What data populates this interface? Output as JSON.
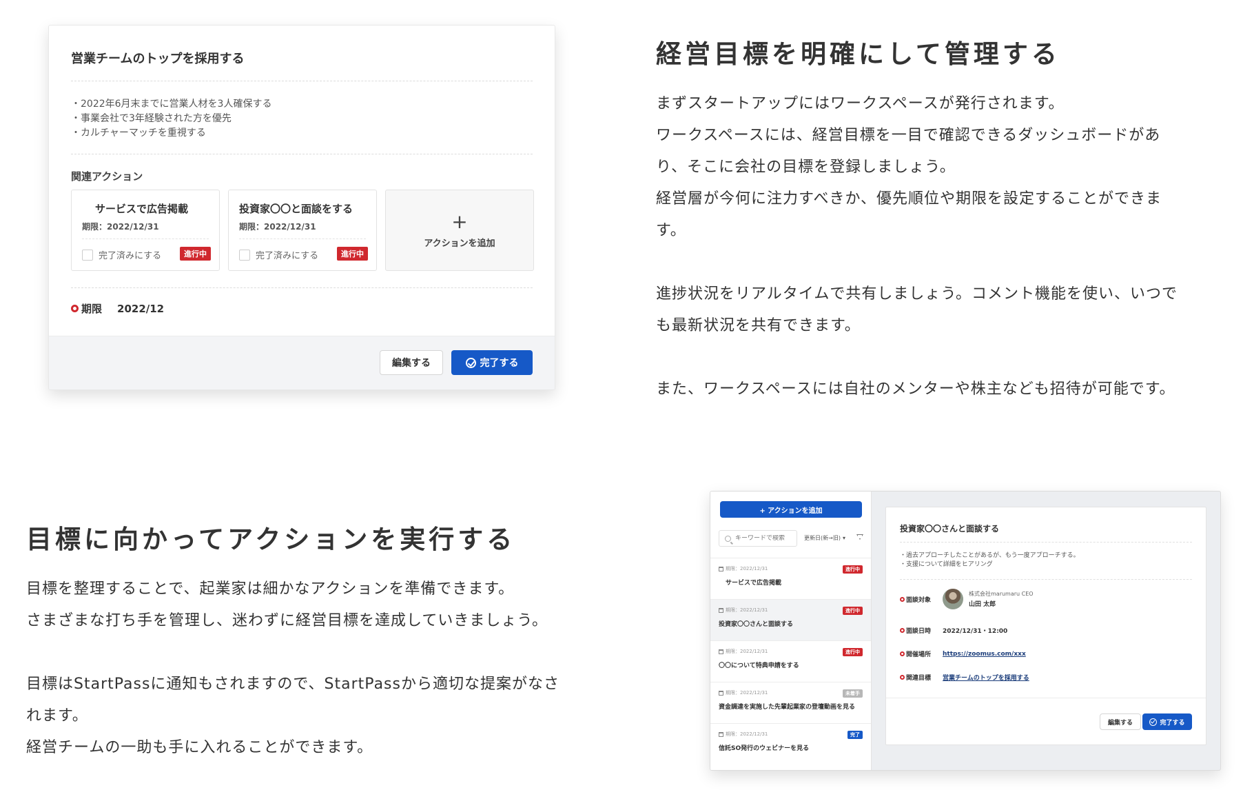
{
  "card_goal": {
    "title": "営業チームのトップを採用する",
    "bullets": [
      "2022年6月末までに営業人材を3人確保する",
      "事業会社で3年経験された方を優先",
      "カルチャーマッチを重視する"
    ],
    "related_label": "関連アクション",
    "actions": [
      {
        "title": "サービスで広告掲載",
        "due": "期限：2022/12/31",
        "check_label": "完了済みにする",
        "status": "進行中"
      },
      {
        "title": "投資家〇〇と面談をする",
        "due": "期限：2022/12/31",
        "check_label": "完了済みにする",
        "status": "進行中"
      }
    ],
    "add_action": {
      "icon": "plus-icon",
      "label": "アクションを追加"
    },
    "due_label": "期限",
    "due_value": "2022/12",
    "edit_button": "編集する",
    "done_button": "完了する"
  },
  "section_manage": {
    "heading": "経営目標を明確にして管理する",
    "paragraphs": [
      [
        "まずスタートアップにはワークスペースが発行されます。",
        "ワークスペースには、経営目標を一目で確認できるダッシュボードがあ",
        "り、そこに会社の目標を登録しましょう。",
        "経営層が今何に注力すべきか、優先順位や期限を設定することができま",
        "す。"
      ],
      [
        "進捗状況をリアルタイムで共有しましょう。コメント機能を使い、いつで",
        "も最新状況を共有できます。"
      ],
      [
        "また、ワークスペースには自社のメンターや株主なども招待が可能です。"
      ]
    ]
  },
  "section_action": {
    "heading": "目標に向かってアクションを実行する",
    "paragraphs": [
      [
        "目標を整理することで、起業家は細かなアクションを準備できます。",
        "さまざまな打ち手を管理し、迷わずに経営目標を達成していきましょう。"
      ],
      [
        "目標はStartPassに通知もされますので、StartPassから適切な提案がなさ",
        "れます。",
        "経営チームの一助も手に入れることができます。"
      ]
    ]
  },
  "app": {
    "add_button": "+ アクションを追加",
    "search_placeholder": "キーワードで検索",
    "sort_label": "更新日(新→旧)",
    "list": [
      {
        "date": "期限：2022/12/31",
        "title": "サービスで広告掲載",
        "status": "進行中",
        "status_color": "red"
      },
      {
        "date": "期限：2022/12/31",
        "title": "投資家〇〇さんと面談する",
        "status": "進行中",
        "status_color": "red"
      },
      {
        "date": "期限：2022/12/31",
        "title": "〇〇について特典申請をする",
        "status": "進行中",
        "status_color": "red"
      },
      {
        "date": "期限：2022/12/31",
        "title": "資金調達を実施した先輩起業家の登壇動画を見る",
        "status": "未着手",
        "status_color": "gray"
      },
      {
        "date": "期限：2022/12/31",
        "title": "信託SO発行のウェビナーを見る",
        "status": "完了",
        "status_color": "blue"
      }
    ],
    "detail": {
      "title": "投資家〇〇さんと面談する",
      "bullets": [
        "過去アプローチしたことがあるが、もう一度アプローチする。",
        "支援について詳細をヒアリング"
      ],
      "target_label": "面談対象",
      "target_company": "株式会社marumaru CEO",
      "target_name": "山田 太郎",
      "datetime_label": "面談日時",
      "datetime_value": "2022/12/31・12:00",
      "place_label": "開催場所",
      "place_value": "https://zoomus.com/xxx",
      "goal_label": "関連目標",
      "goal_value": "営業チームのトップを採用する",
      "edit_button": "編集する",
      "done_button": "完了する"
    }
  }
}
